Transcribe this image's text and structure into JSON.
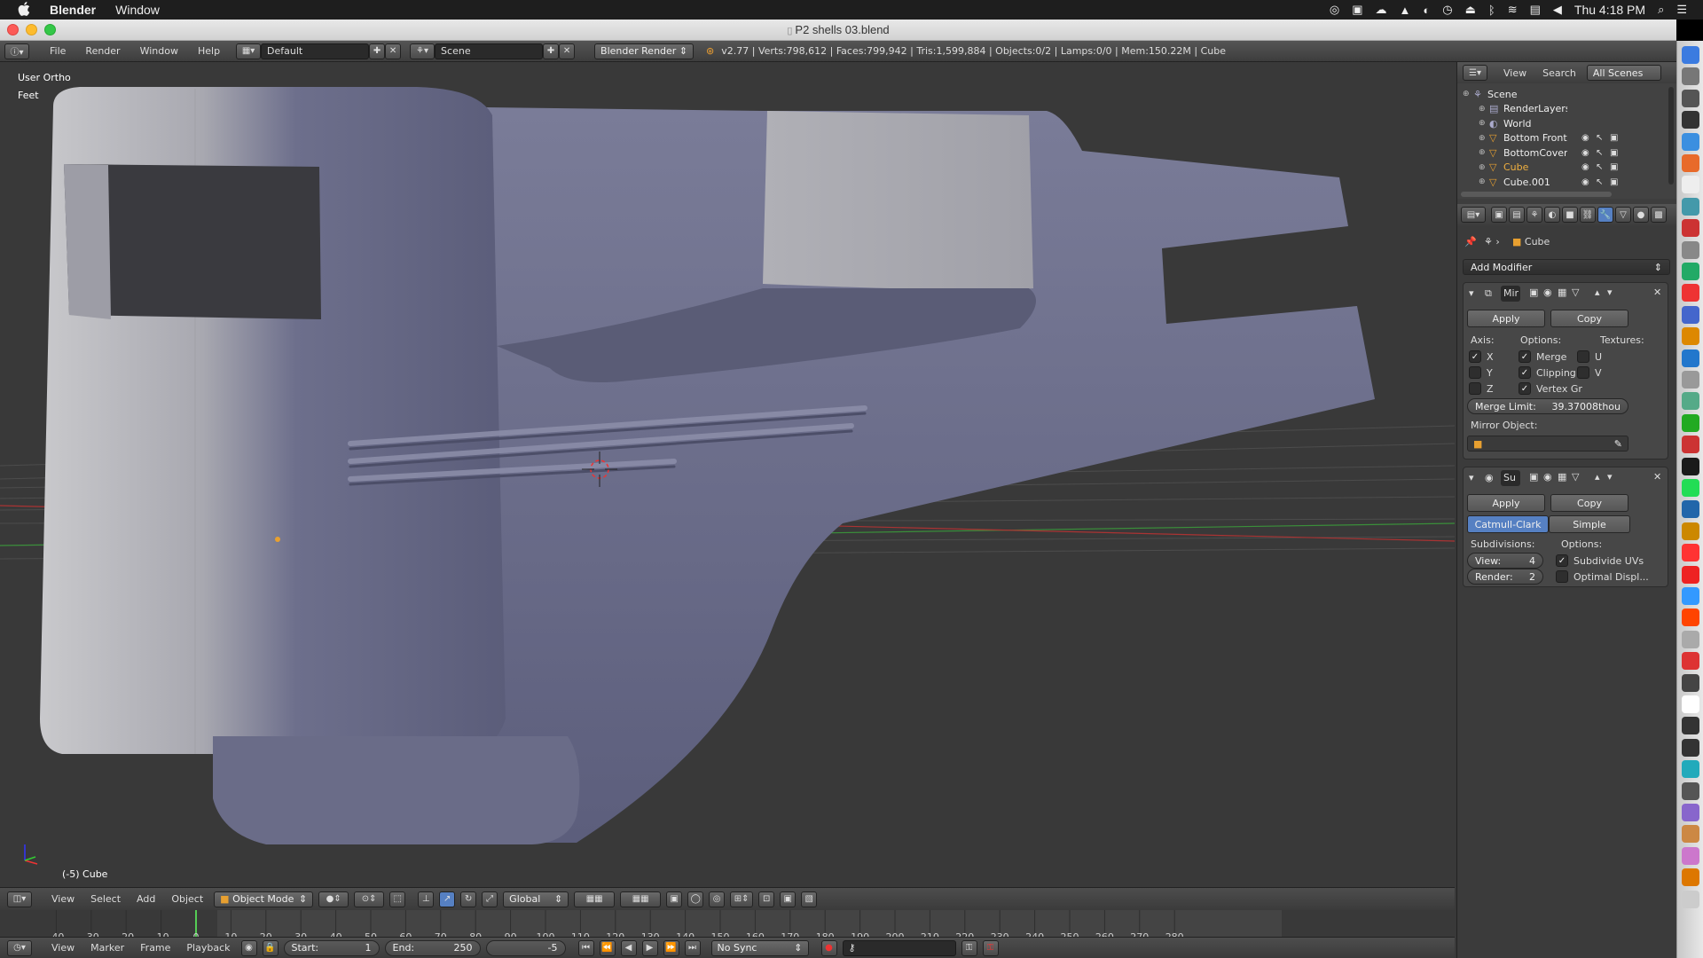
{
  "menubar": {
    "apple": "",
    "app_name": "Blender",
    "items": [
      "Window"
    ],
    "clock": "Thu 4:18 PM"
  },
  "window": {
    "title": "P2 shells 03.blend"
  },
  "info_header": {
    "menus": [
      "File",
      "Render",
      "Window",
      "Help"
    ],
    "screen_layout": "Default",
    "scene": "Scene",
    "render_engine": "Blender Render",
    "stats": "v2.77 | Verts:798,612 | Faces:799,942 | Tris:1,599,884 | Objects:0/2 | Lamps:0/0 | Mem:150.22M | Cube"
  },
  "viewport": {
    "view_name": "User Ortho",
    "units": "Feet",
    "active_object": "(-5) Cube",
    "header": {
      "menus": [
        "View",
        "Select",
        "Add",
        "Object"
      ],
      "mode": "Object Mode",
      "orientation": "Global"
    }
  },
  "outliner": {
    "header": {
      "view": "View",
      "search": "Search",
      "filter": "All Scenes"
    },
    "items": [
      {
        "label": "Scene",
        "indent": 0
      },
      {
        "label": "RenderLayers",
        "indent": 1
      },
      {
        "label": "World",
        "indent": 1
      },
      {
        "label": "Bottom Front",
        "indent": 1
      },
      {
        "label": "BottomCover",
        "indent": 1
      },
      {
        "label": "Cube",
        "indent": 1
      },
      {
        "label": "Cube.001",
        "indent": 1
      }
    ]
  },
  "properties": {
    "context_object": "Cube",
    "add_modifier": "Add Modifier",
    "mirror": {
      "name": "Mir",
      "apply": "Apply",
      "copy": "Copy",
      "axis_label": "Axis:",
      "options_label": "Options:",
      "textures_label": "Textures:",
      "axis": [
        {
          "label": "X",
          "checked": true
        },
        {
          "label": "Y",
          "checked": false
        },
        {
          "label": "Z",
          "checked": false
        }
      ],
      "options": [
        {
          "label": "Merge",
          "checked": true
        },
        {
          "label": "Clipping",
          "checked": true
        },
        {
          "label": "Vertex Gr",
          "checked": true
        }
      ],
      "textures": [
        {
          "label": "U",
          "checked": false
        },
        {
          "label": "V",
          "checked": false
        }
      ],
      "merge_limit_label": "Merge Limit:",
      "merge_limit_value": "39.37008thou",
      "mirror_object_label": "Mirror Object:"
    },
    "subsurf": {
      "name": "Su",
      "apply": "Apply",
      "copy": "Copy",
      "tabs": [
        "Catmull-Clark",
        "Simple"
      ],
      "active_tab": "Catmull-Clark",
      "subdivisions_label": "Subdivisions:",
      "options_label": "Options:",
      "view_label": "View:",
      "view_value": "4",
      "render_label": "Render:",
      "render_value": "2",
      "subdivide_uvs": "Subdivide UVs",
      "subdivide_uvs_checked": true,
      "optimal_display": "Optimal Displ...",
      "optimal_display_checked": false
    }
  },
  "timeline": {
    "ticks": [
      "-40",
      "-30",
      "-20",
      "-10",
      "0",
      "10",
      "20",
      "30",
      "40",
      "50",
      "60",
      "70",
      "80",
      "90",
      "100",
      "110",
      "120",
      "130",
      "140",
      "150",
      "160",
      "170",
      "180",
      "190",
      "200",
      "210",
      "220",
      "230",
      "240",
      "250",
      "260",
      "270",
      "280"
    ],
    "current_frame": 0,
    "header": {
      "menus": [
        "View",
        "Marker",
        "Frame",
        "Playback"
      ],
      "start_label": "Start:",
      "start_value": "1",
      "end_label": "End:",
      "end_value": "250",
      "current_value": "-5",
      "sync": "No Sync"
    }
  },
  "colors": {
    "accent_blue": "#5680c2",
    "viewport_bg": "#393939",
    "model_color": "#6f7194",
    "x_axis": "#c0392b",
    "y_axis": "#3a9b3a"
  }
}
